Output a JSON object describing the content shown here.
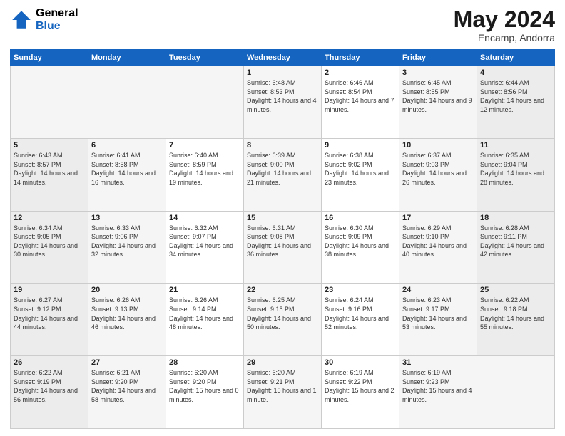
{
  "header": {
    "logo_line1": "General",
    "logo_line2": "Blue",
    "month": "May 2024",
    "location": "Encamp, Andorra"
  },
  "weekdays": [
    "Sunday",
    "Monday",
    "Tuesday",
    "Wednesday",
    "Thursday",
    "Friday",
    "Saturday"
  ],
  "weeks": [
    [
      {
        "day": "",
        "sunrise": "",
        "sunset": "",
        "daylight": ""
      },
      {
        "day": "",
        "sunrise": "",
        "sunset": "",
        "daylight": ""
      },
      {
        "day": "",
        "sunrise": "",
        "sunset": "",
        "daylight": ""
      },
      {
        "day": "1",
        "sunrise": "Sunrise: 6:48 AM",
        "sunset": "Sunset: 8:53 PM",
        "daylight": "Daylight: 14 hours and 4 minutes."
      },
      {
        "day": "2",
        "sunrise": "Sunrise: 6:46 AM",
        "sunset": "Sunset: 8:54 PM",
        "daylight": "Daylight: 14 hours and 7 minutes."
      },
      {
        "day": "3",
        "sunrise": "Sunrise: 6:45 AM",
        "sunset": "Sunset: 8:55 PM",
        "daylight": "Daylight: 14 hours and 9 minutes."
      },
      {
        "day": "4",
        "sunrise": "Sunrise: 6:44 AM",
        "sunset": "Sunset: 8:56 PM",
        "daylight": "Daylight: 14 hours and 12 minutes."
      }
    ],
    [
      {
        "day": "5",
        "sunrise": "Sunrise: 6:43 AM",
        "sunset": "Sunset: 8:57 PM",
        "daylight": "Daylight: 14 hours and 14 minutes."
      },
      {
        "day": "6",
        "sunrise": "Sunrise: 6:41 AM",
        "sunset": "Sunset: 8:58 PM",
        "daylight": "Daylight: 14 hours and 16 minutes."
      },
      {
        "day": "7",
        "sunrise": "Sunrise: 6:40 AM",
        "sunset": "Sunset: 8:59 PM",
        "daylight": "Daylight: 14 hours and 19 minutes."
      },
      {
        "day": "8",
        "sunrise": "Sunrise: 6:39 AM",
        "sunset": "Sunset: 9:00 PM",
        "daylight": "Daylight: 14 hours and 21 minutes."
      },
      {
        "day": "9",
        "sunrise": "Sunrise: 6:38 AM",
        "sunset": "Sunset: 9:02 PM",
        "daylight": "Daylight: 14 hours and 23 minutes."
      },
      {
        "day": "10",
        "sunrise": "Sunrise: 6:37 AM",
        "sunset": "Sunset: 9:03 PM",
        "daylight": "Daylight: 14 hours and 26 minutes."
      },
      {
        "day": "11",
        "sunrise": "Sunrise: 6:35 AM",
        "sunset": "Sunset: 9:04 PM",
        "daylight": "Daylight: 14 hours and 28 minutes."
      }
    ],
    [
      {
        "day": "12",
        "sunrise": "Sunrise: 6:34 AM",
        "sunset": "Sunset: 9:05 PM",
        "daylight": "Daylight: 14 hours and 30 minutes."
      },
      {
        "day": "13",
        "sunrise": "Sunrise: 6:33 AM",
        "sunset": "Sunset: 9:06 PM",
        "daylight": "Daylight: 14 hours and 32 minutes."
      },
      {
        "day": "14",
        "sunrise": "Sunrise: 6:32 AM",
        "sunset": "Sunset: 9:07 PM",
        "daylight": "Daylight: 14 hours and 34 minutes."
      },
      {
        "day": "15",
        "sunrise": "Sunrise: 6:31 AM",
        "sunset": "Sunset: 9:08 PM",
        "daylight": "Daylight: 14 hours and 36 minutes."
      },
      {
        "day": "16",
        "sunrise": "Sunrise: 6:30 AM",
        "sunset": "Sunset: 9:09 PM",
        "daylight": "Daylight: 14 hours and 38 minutes."
      },
      {
        "day": "17",
        "sunrise": "Sunrise: 6:29 AM",
        "sunset": "Sunset: 9:10 PM",
        "daylight": "Daylight: 14 hours and 40 minutes."
      },
      {
        "day": "18",
        "sunrise": "Sunrise: 6:28 AM",
        "sunset": "Sunset: 9:11 PM",
        "daylight": "Daylight: 14 hours and 42 minutes."
      }
    ],
    [
      {
        "day": "19",
        "sunrise": "Sunrise: 6:27 AM",
        "sunset": "Sunset: 9:12 PM",
        "daylight": "Daylight: 14 hours and 44 minutes."
      },
      {
        "day": "20",
        "sunrise": "Sunrise: 6:26 AM",
        "sunset": "Sunset: 9:13 PM",
        "daylight": "Daylight: 14 hours and 46 minutes."
      },
      {
        "day": "21",
        "sunrise": "Sunrise: 6:26 AM",
        "sunset": "Sunset: 9:14 PM",
        "daylight": "Daylight: 14 hours and 48 minutes."
      },
      {
        "day": "22",
        "sunrise": "Sunrise: 6:25 AM",
        "sunset": "Sunset: 9:15 PM",
        "daylight": "Daylight: 14 hours and 50 minutes."
      },
      {
        "day": "23",
        "sunrise": "Sunrise: 6:24 AM",
        "sunset": "Sunset: 9:16 PM",
        "daylight": "Daylight: 14 hours and 52 minutes."
      },
      {
        "day": "24",
        "sunrise": "Sunrise: 6:23 AM",
        "sunset": "Sunset: 9:17 PM",
        "daylight": "Daylight: 14 hours and 53 minutes."
      },
      {
        "day": "25",
        "sunrise": "Sunrise: 6:22 AM",
        "sunset": "Sunset: 9:18 PM",
        "daylight": "Daylight: 14 hours and 55 minutes."
      }
    ],
    [
      {
        "day": "26",
        "sunrise": "Sunrise: 6:22 AM",
        "sunset": "Sunset: 9:19 PM",
        "daylight": "Daylight: 14 hours and 56 minutes."
      },
      {
        "day": "27",
        "sunrise": "Sunrise: 6:21 AM",
        "sunset": "Sunset: 9:20 PM",
        "daylight": "Daylight: 14 hours and 58 minutes."
      },
      {
        "day": "28",
        "sunrise": "Sunrise: 6:20 AM",
        "sunset": "Sunset: 9:20 PM",
        "daylight": "Daylight: 15 hours and 0 minutes."
      },
      {
        "day": "29",
        "sunrise": "Sunrise: 6:20 AM",
        "sunset": "Sunset: 9:21 PM",
        "daylight": "Daylight: 15 hours and 1 minute."
      },
      {
        "day": "30",
        "sunrise": "Sunrise: 6:19 AM",
        "sunset": "Sunset: 9:22 PM",
        "daylight": "Daylight: 15 hours and 2 minutes."
      },
      {
        "day": "31",
        "sunrise": "Sunrise: 6:19 AM",
        "sunset": "Sunset: 9:23 PM",
        "daylight": "Daylight: 15 hours and 4 minutes."
      },
      {
        "day": "",
        "sunrise": "",
        "sunset": "",
        "daylight": ""
      }
    ]
  ]
}
